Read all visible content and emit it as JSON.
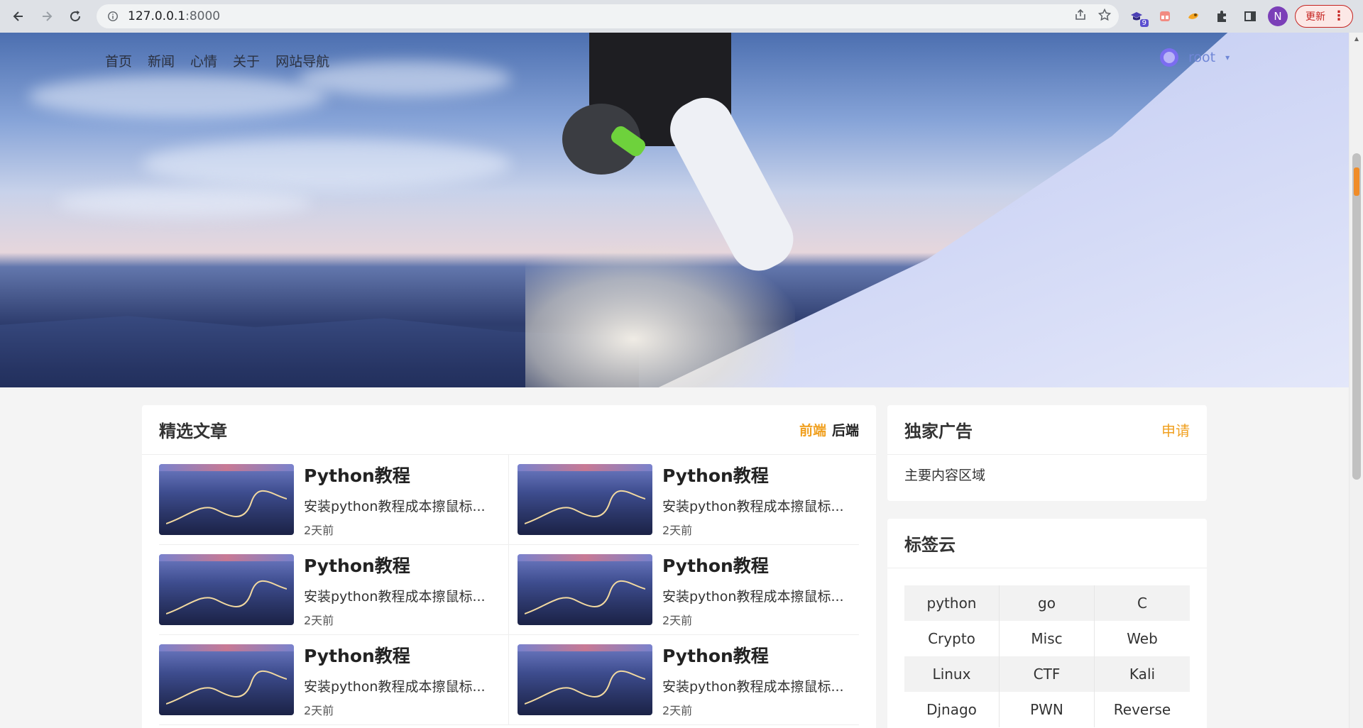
{
  "browser": {
    "url_host": "127.0.0.1",
    "url_port": ":8000",
    "ext_badge": "9",
    "profile_initial": "N",
    "update_label": "更新"
  },
  "nav": {
    "items": [
      "首页",
      "新闻",
      "心情",
      "关于",
      "网站导航"
    ]
  },
  "user": {
    "name": "root"
  },
  "featured": {
    "title": "精选文章",
    "tabs": [
      "前端",
      "后端"
    ],
    "articles": [
      {
        "title": "Python教程",
        "desc": "安装python教程成本擦鼠标...",
        "time": "2天前"
      },
      {
        "title": "Python教程",
        "desc": "安装python教程成本擦鼠标...",
        "time": "2天前"
      },
      {
        "title": "Python教程",
        "desc": "安装python教程成本擦鼠标...",
        "time": "2天前"
      },
      {
        "title": "Python教程",
        "desc": "安装python教程成本擦鼠标...",
        "time": "2天前"
      },
      {
        "title": "Python教程",
        "desc": "安装python教程成本擦鼠标...",
        "time": "2天前"
      },
      {
        "title": "Python教程",
        "desc": "安装python教程成本擦鼠标...",
        "time": "2天前"
      }
    ]
  },
  "ad": {
    "title": "独家广告",
    "apply_label": "申请",
    "body": "主要内容区域"
  },
  "tags": {
    "title": "标签云",
    "items": [
      "python",
      "go",
      "C",
      "Crypto",
      "Misc",
      "Web",
      "Linux",
      "CTF",
      "Kali",
      "Djnago",
      "PWN",
      "Reverse"
    ]
  },
  "colors": {
    "accent": "#f0a020",
    "user_link": "#6f86d6"
  }
}
